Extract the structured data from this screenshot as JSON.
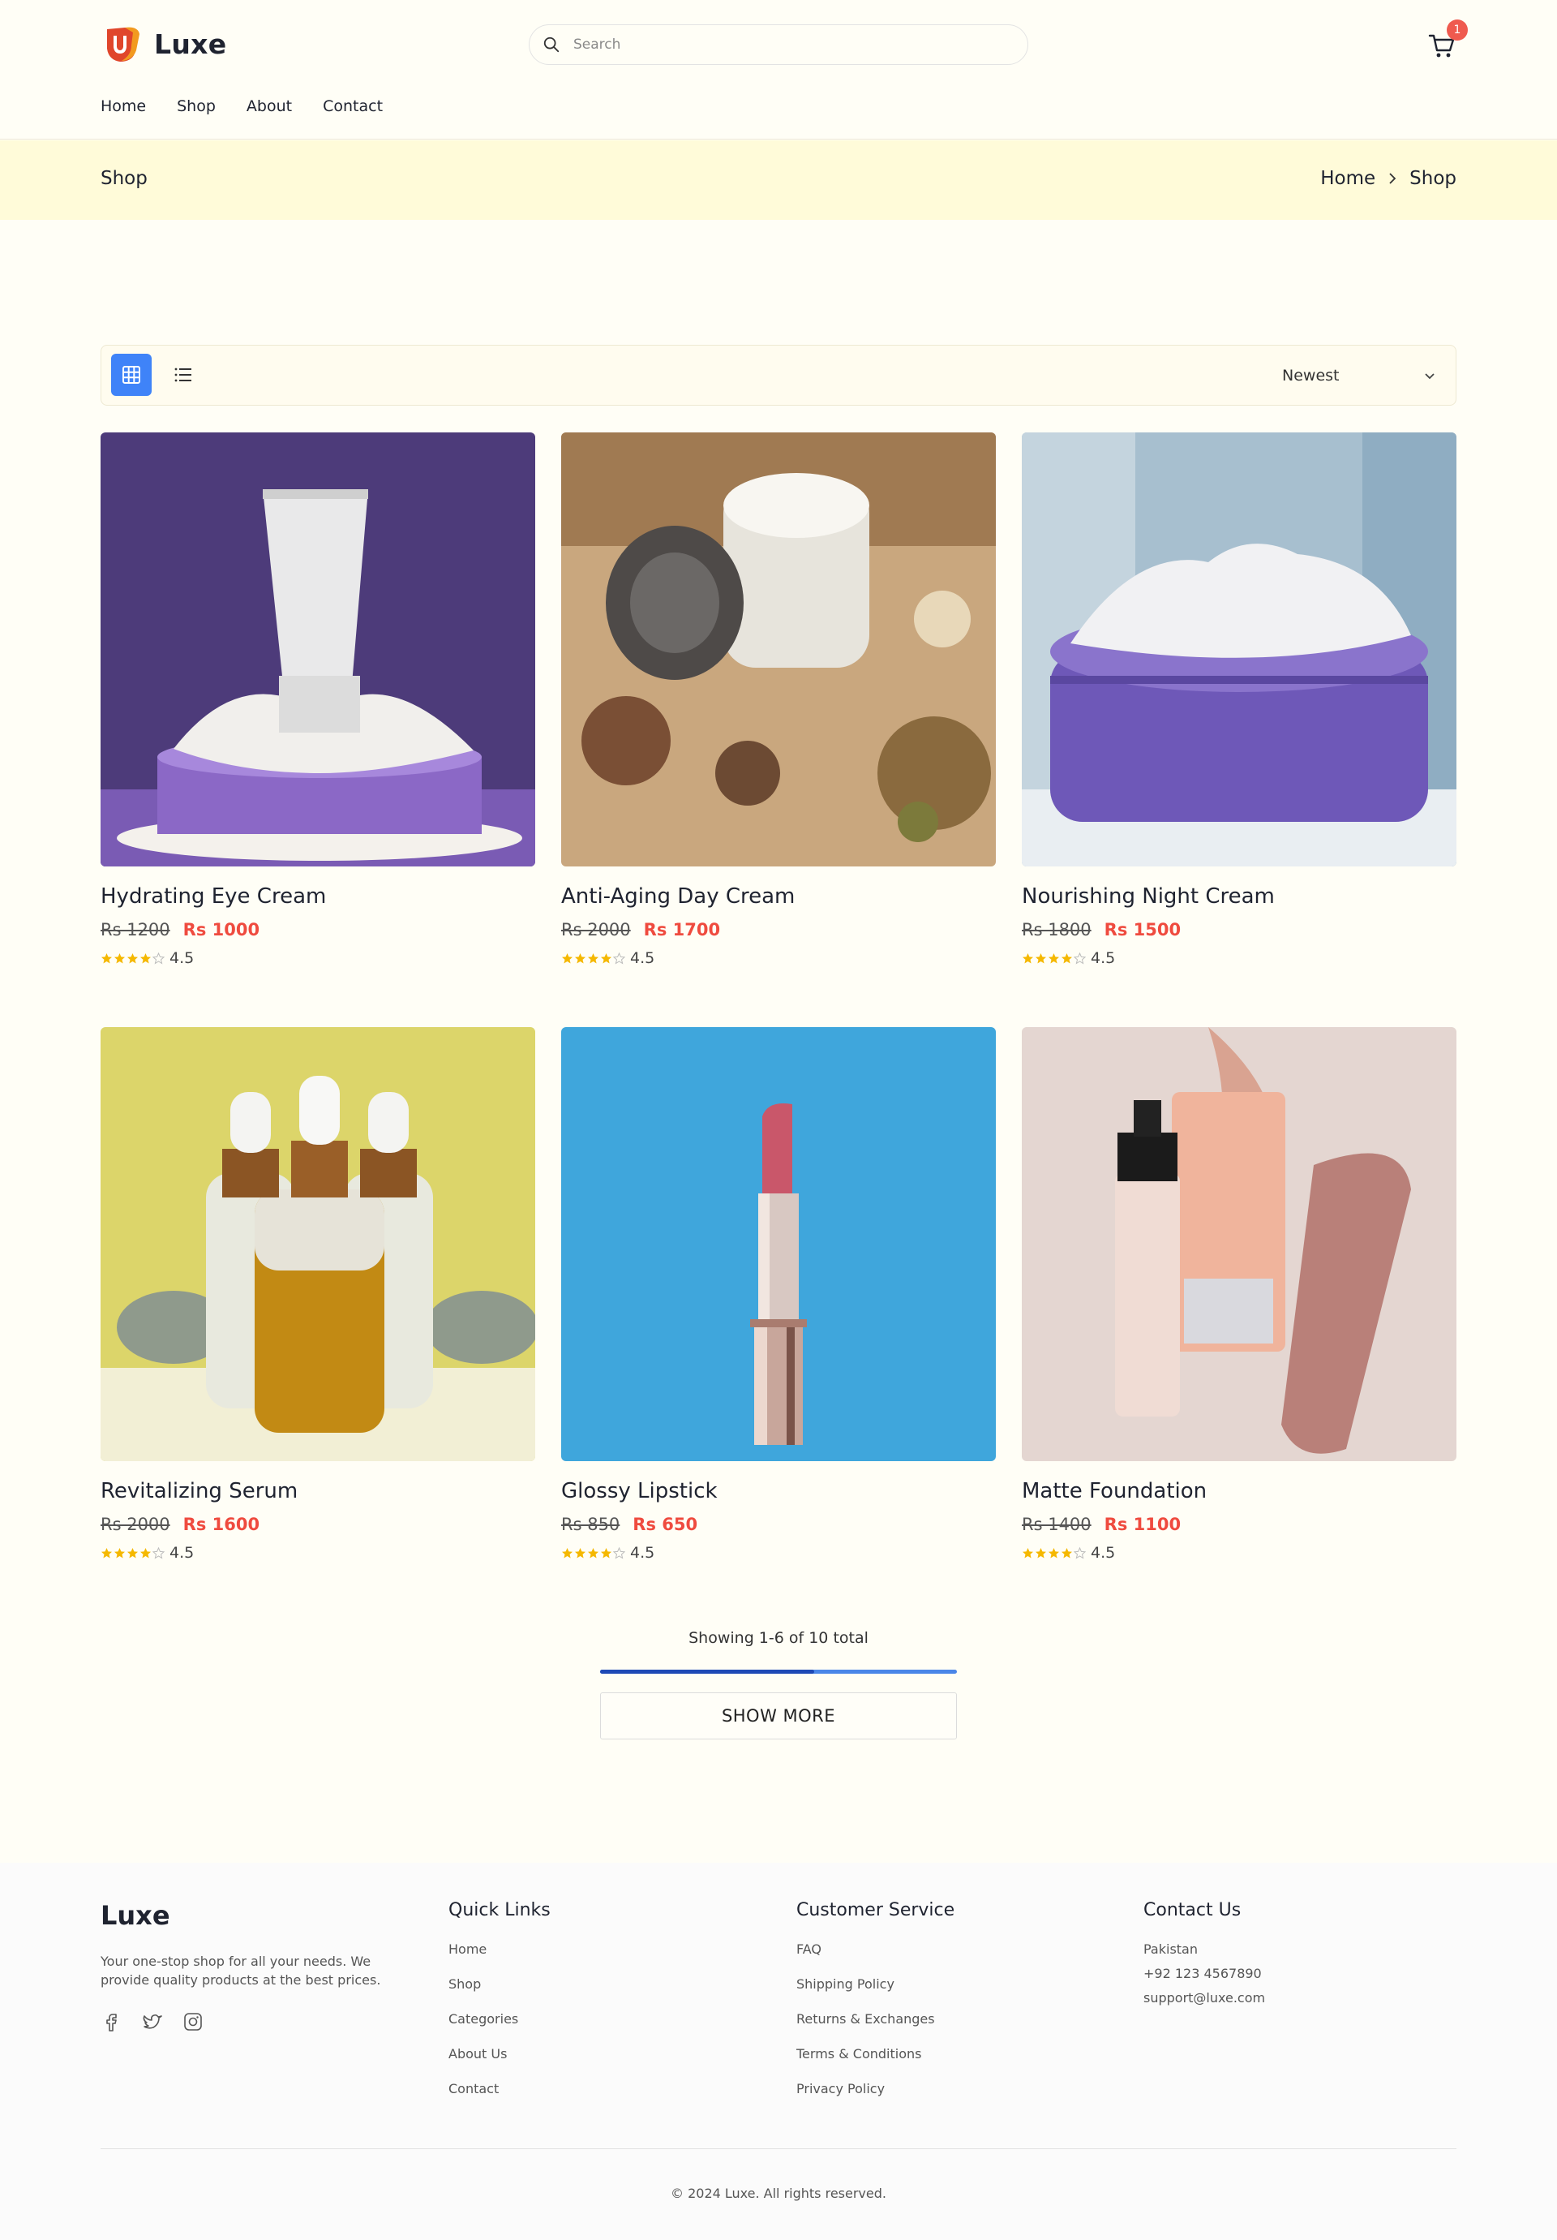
{
  "header": {
    "brand": "Luxe",
    "search_placeholder": "Search",
    "cart_count": "1",
    "nav": [
      "Home",
      "Shop",
      "About",
      "Contact"
    ]
  },
  "breadcrumb": {
    "title": "Shop",
    "trail": [
      "Home",
      "Shop"
    ]
  },
  "toolbar": {
    "sort_value": "Newest"
  },
  "products": [
    {
      "name": "Hydrating Eye Cream",
      "old_price": "Rs 1200",
      "price": "Rs 1000",
      "rating": "4.5"
    },
    {
      "name": "Anti-Aging Day Cream",
      "old_price": "Rs 2000",
      "price": "Rs 1700",
      "rating": "4.5"
    },
    {
      "name": "Nourishing Night Cream",
      "old_price": "Rs 1800",
      "price": "Rs 1500",
      "rating": "4.5"
    },
    {
      "name": "Revitalizing Serum",
      "old_price": "Rs 2000",
      "price": "Rs 1600",
      "rating": "4.5"
    },
    {
      "name": "Glossy Lipstick",
      "old_price": "Rs 850",
      "price": "Rs 650",
      "rating": "4.5"
    },
    {
      "name": "Matte Foundation",
      "old_price": "Rs 1400",
      "price": "Rs 1100",
      "rating": "4.5"
    }
  ],
  "pagination": {
    "showing": "Showing 1-6 of 10 total",
    "progress_fraction": 0.6,
    "button": "SHOW MORE"
  },
  "colors": {
    "accent": "#3f83f8",
    "sale_price": "#ef4b3f",
    "star": "#f5b800",
    "badge": "#ef5a4f",
    "breadcrumb_bg": "#fffbd9"
  },
  "footer": {
    "brand": "Luxe",
    "about": "Your one-stop shop for all your needs. We provide quality products at the best prices.",
    "social_icons": [
      "facebook-icon",
      "twitter-icon",
      "instagram-icon"
    ],
    "quick_links": {
      "title": "Quick Links",
      "items": [
        "Home",
        "Shop",
        "Categories",
        "About Us",
        "Contact"
      ]
    },
    "customer_service": {
      "title": "Customer Service",
      "items": [
        "FAQ",
        "Shipping Policy",
        "Returns & Exchanges",
        "Terms & Conditions",
        "Privacy Policy"
      ]
    },
    "contact": {
      "title": "Contact Us",
      "items": [
        "Pakistan",
        "+92 123 4567890",
        "support@luxe.com"
      ]
    },
    "copyright": "© 2024 Luxe. All rights reserved."
  }
}
